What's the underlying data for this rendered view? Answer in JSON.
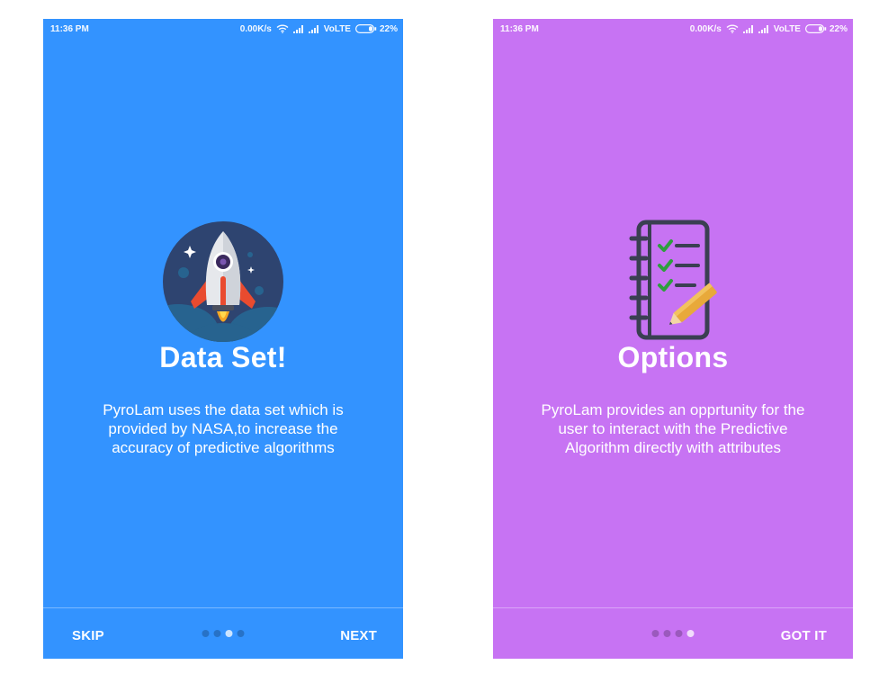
{
  "screens": [
    {
      "background": "#3393ff",
      "status_bar": {
        "time": "11:36 PM",
        "speed": "0.00K/s",
        "network": "VoLTE",
        "battery": "22%"
      },
      "illustration": "rocket-icon",
      "title": "Data Set!",
      "description": "PyroLam uses the data set which is provided by NASA,to increase the accuracy of predictive algorithms",
      "left_button": "SKIP",
      "right_button": "NEXT",
      "page_indicator": {
        "total": 4,
        "current": 3
      }
    },
    {
      "background": "#c773f3",
      "status_bar": {
        "time": "11:36 PM",
        "speed": "0.00K/s",
        "network": "VoLTE",
        "battery": "22%"
      },
      "illustration": "notebook-checklist-icon",
      "title": "Options",
      "description": "PyroLam provides an opprtunity for the user to interact with the Predictive Algorithm directly with attributes",
      "left_button": "",
      "right_button": "GOT IT",
      "page_indicator": {
        "total": 4,
        "current": 4
      }
    }
  ]
}
